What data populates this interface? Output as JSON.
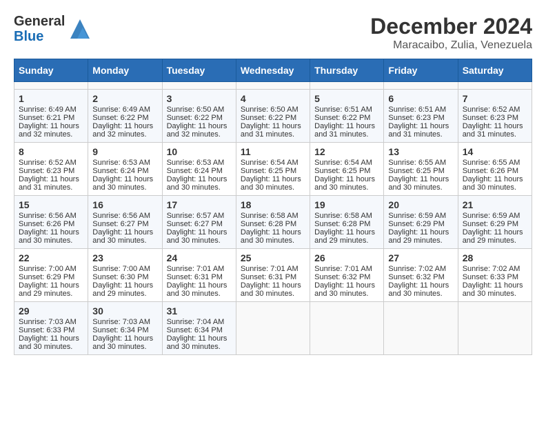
{
  "header": {
    "logo_line1": "General",
    "logo_line2": "Blue",
    "title": "December 2024",
    "subtitle": "Maracaibo, Zulia, Venezuela"
  },
  "calendar": {
    "days_of_week": [
      "Sunday",
      "Monday",
      "Tuesday",
      "Wednesday",
      "Thursday",
      "Friday",
      "Saturday"
    ],
    "weeks": [
      [
        {
          "day": "",
          "sunrise": "",
          "sunset": "",
          "daylight": ""
        },
        {
          "day": "",
          "sunrise": "",
          "sunset": "",
          "daylight": ""
        },
        {
          "day": "",
          "sunrise": "",
          "sunset": "",
          "daylight": ""
        },
        {
          "day": "",
          "sunrise": "",
          "sunset": "",
          "daylight": ""
        },
        {
          "day": "",
          "sunrise": "",
          "sunset": "",
          "daylight": ""
        },
        {
          "day": "",
          "sunrise": "",
          "sunset": "",
          "daylight": ""
        },
        {
          "day": "",
          "sunrise": "",
          "sunset": "",
          "daylight": ""
        }
      ],
      [
        {
          "day": "1",
          "sunrise": "Sunrise: 6:49 AM",
          "sunset": "Sunset: 6:21 PM",
          "daylight": "Daylight: 11 hours and 32 minutes."
        },
        {
          "day": "2",
          "sunrise": "Sunrise: 6:49 AM",
          "sunset": "Sunset: 6:22 PM",
          "daylight": "Daylight: 11 hours and 32 minutes."
        },
        {
          "day": "3",
          "sunrise": "Sunrise: 6:50 AM",
          "sunset": "Sunset: 6:22 PM",
          "daylight": "Daylight: 11 hours and 32 minutes."
        },
        {
          "day": "4",
          "sunrise": "Sunrise: 6:50 AM",
          "sunset": "Sunset: 6:22 PM",
          "daylight": "Daylight: 11 hours and 31 minutes."
        },
        {
          "day": "5",
          "sunrise": "Sunrise: 6:51 AM",
          "sunset": "Sunset: 6:22 PM",
          "daylight": "Daylight: 11 hours and 31 minutes."
        },
        {
          "day": "6",
          "sunrise": "Sunrise: 6:51 AM",
          "sunset": "Sunset: 6:23 PM",
          "daylight": "Daylight: 11 hours and 31 minutes."
        },
        {
          "day": "7",
          "sunrise": "Sunrise: 6:52 AM",
          "sunset": "Sunset: 6:23 PM",
          "daylight": "Daylight: 11 hours and 31 minutes."
        }
      ],
      [
        {
          "day": "8",
          "sunrise": "Sunrise: 6:52 AM",
          "sunset": "Sunset: 6:23 PM",
          "daylight": "Daylight: 11 hours and 31 minutes."
        },
        {
          "day": "9",
          "sunrise": "Sunrise: 6:53 AM",
          "sunset": "Sunset: 6:24 PM",
          "daylight": "Daylight: 11 hours and 30 minutes."
        },
        {
          "day": "10",
          "sunrise": "Sunrise: 6:53 AM",
          "sunset": "Sunset: 6:24 PM",
          "daylight": "Daylight: 11 hours and 30 minutes."
        },
        {
          "day": "11",
          "sunrise": "Sunrise: 6:54 AM",
          "sunset": "Sunset: 6:25 PM",
          "daylight": "Daylight: 11 hours and 30 minutes."
        },
        {
          "day": "12",
          "sunrise": "Sunrise: 6:54 AM",
          "sunset": "Sunset: 6:25 PM",
          "daylight": "Daylight: 11 hours and 30 minutes."
        },
        {
          "day": "13",
          "sunrise": "Sunrise: 6:55 AM",
          "sunset": "Sunset: 6:25 PM",
          "daylight": "Daylight: 11 hours and 30 minutes."
        },
        {
          "day": "14",
          "sunrise": "Sunrise: 6:55 AM",
          "sunset": "Sunset: 6:26 PM",
          "daylight": "Daylight: 11 hours and 30 minutes."
        }
      ],
      [
        {
          "day": "15",
          "sunrise": "Sunrise: 6:56 AM",
          "sunset": "Sunset: 6:26 PM",
          "daylight": "Daylight: 11 hours and 30 minutes."
        },
        {
          "day": "16",
          "sunrise": "Sunrise: 6:56 AM",
          "sunset": "Sunset: 6:27 PM",
          "daylight": "Daylight: 11 hours and 30 minutes."
        },
        {
          "day": "17",
          "sunrise": "Sunrise: 6:57 AM",
          "sunset": "Sunset: 6:27 PM",
          "daylight": "Daylight: 11 hours and 30 minutes."
        },
        {
          "day": "18",
          "sunrise": "Sunrise: 6:58 AM",
          "sunset": "Sunset: 6:28 PM",
          "daylight": "Daylight: 11 hours and 30 minutes."
        },
        {
          "day": "19",
          "sunrise": "Sunrise: 6:58 AM",
          "sunset": "Sunset: 6:28 PM",
          "daylight": "Daylight: 11 hours and 29 minutes."
        },
        {
          "day": "20",
          "sunrise": "Sunrise: 6:59 AM",
          "sunset": "Sunset: 6:29 PM",
          "daylight": "Daylight: 11 hours and 29 minutes."
        },
        {
          "day": "21",
          "sunrise": "Sunrise: 6:59 AM",
          "sunset": "Sunset: 6:29 PM",
          "daylight": "Daylight: 11 hours and 29 minutes."
        }
      ],
      [
        {
          "day": "22",
          "sunrise": "Sunrise: 7:00 AM",
          "sunset": "Sunset: 6:29 PM",
          "daylight": "Daylight: 11 hours and 29 minutes."
        },
        {
          "day": "23",
          "sunrise": "Sunrise: 7:00 AM",
          "sunset": "Sunset: 6:30 PM",
          "daylight": "Daylight: 11 hours and 29 minutes."
        },
        {
          "day": "24",
          "sunrise": "Sunrise: 7:01 AM",
          "sunset": "Sunset: 6:31 PM",
          "daylight": "Daylight: 11 hours and 30 minutes."
        },
        {
          "day": "25",
          "sunrise": "Sunrise: 7:01 AM",
          "sunset": "Sunset: 6:31 PM",
          "daylight": "Daylight: 11 hours and 30 minutes."
        },
        {
          "day": "26",
          "sunrise": "Sunrise: 7:01 AM",
          "sunset": "Sunset: 6:32 PM",
          "daylight": "Daylight: 11 hours and 30 minutes."
        },
        {
          "day": "27",
          "sunrise": "Sunrise: 7:02 AM",
          "sunset": "Sunset: 6:32 PM",
          "daylight": "Daylight: 11 hours and 30 minutes."
        },
        {
          "day": "28",
          "sunrise": "Sunrise: 7:02 AM",
          "sunset": "Sunset: 6:33 PM",
          "daylight": "Daylight: 11 hours and 30 minutes."
        }
      ],
      [
        {
          "day": "29",
          "sunrise": "Sunrise: 7:03 AM",
          "sunset": "Sunset: 6:33 PM",
          "daylight": "Daylight: 11 hours and 30 minutes."
        },
        {
          "day": "30",
          "sunrise": "Sunrise: 7:03 AM",
          "sunset": "Sunset: 6:34 PM",
          "daylight": "Daylight: 11 hours and 30 minutes."
        },
        {
          "day": "31",
          "sunrise": "Sunrise: 7:04 AM",
          "sunset": "Sunset: 6:34 PM",
          "daylight": "Daylight: 11 hours and 30 minutes."
        },
        {
          "day": "",
          "sunrise": "",
          "sunset": "",
          "daylight": ""
        },
        {
          "day": "",
          "sunrise": "",
          "sunset": "",
          "daylight": ""
        },
        {
          "day": "",
          "sunrise": "",
          "sunset": "",
          "daylight": ""
        },
        {
          "day": "",
          "sunrise": "",
          "sunset": "",
          "daylight": ""
        }
      ]
    ]
  }
}
